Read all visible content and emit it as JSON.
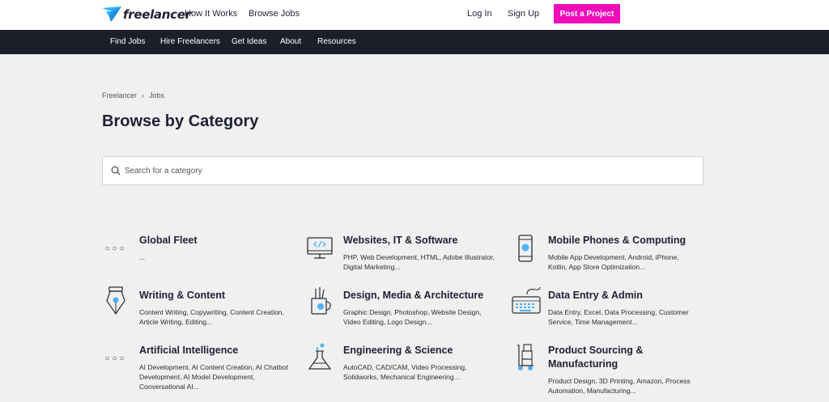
{
  "header": {
    "logo_text": "freelancer",
    "links": [
      "How It Works",
      "Browse Jobs"
    ],
    "login": "Log In",
    "signup": "Sign Up",
    "post_project": "Post a Project"
  },
  "nav": {
    "items": [
      "Find Jobs",
      "Hire Freelancers",
      "Get Ideas",
      "About",
      "Resources"
    ]
  },
  "breadcrumb": {
    "items": [
      "Freelancer",
      "Jobs"
    ],
    "separator": "›"
  },
  "page_title": "Browse by Category",
  "search": {
    "placeholder": "Search for a category",
    "value": ""
  },
  "categories": [
    {
      "title": "Global Fleet",
      "desc": "...",
      "icon": "dots-icon"
    },
    {
      "title": "Websites, IT & Software",
      "desc": "PHP, Web Development, HTML, Adobe Illustrator, Digital Marketing...",
      "icon": "monitor-code-icon"
    },
    {
      "title": "Mobile Phones & Computing",
      "desc": "Mobile App Development, Android, iPhone, Kotlin, App Store Optimization...",
      "icon": "mobile-phone-icon"
    },
    {
      "title": "Writing & Content",
      "desc": "Content Writing, Copywriting, Content Creation, Article Writing, Editing...",
      "icon": "pen-nib-icon"
    },
    {
      "title": "Design, Media & Architecture",
      "desc": "Graphic Design, Photoshop, Website Design, Video Editing, Logo Design...",
      "icon": "pencil-cup-icon"
    },
    {
      "title": "Data Entry & Admin",
      "desc": "Data Entry, Excel, Data Processing, Customer Service, Time Management...",
      "icon": "keyboard-icon"
    },
    {
      "title": "Artificial Intelligence",
      "desc": "AI Development, AI Content Creation, AI Chatbot Development, AI Model Development, Conversational AI...",
      "icon": "dots-icon"
    },
    {
      "title": "Engineering & Science",
      "desc": "AutoCAD, CAD/CAM, Video Processing, Solidworks, Mechanical Engineering...",
      "icon": "flask-icon"
    },
    {
      "title": "Product Sourcing & Manufacturing",
      "desc": "Product Design, 3D Printing, Amazon, Process Automation, Manufacturing...",
      "icon": "hand-truck-icon"
    }
  ],
  "colors": {
    "accent": "#f10cba",
    "nav_bg": "#1c1e2a",
    "icon_blue": "#4fb3f5",
    "logo_blue": "#29b2fe"
  }
}
